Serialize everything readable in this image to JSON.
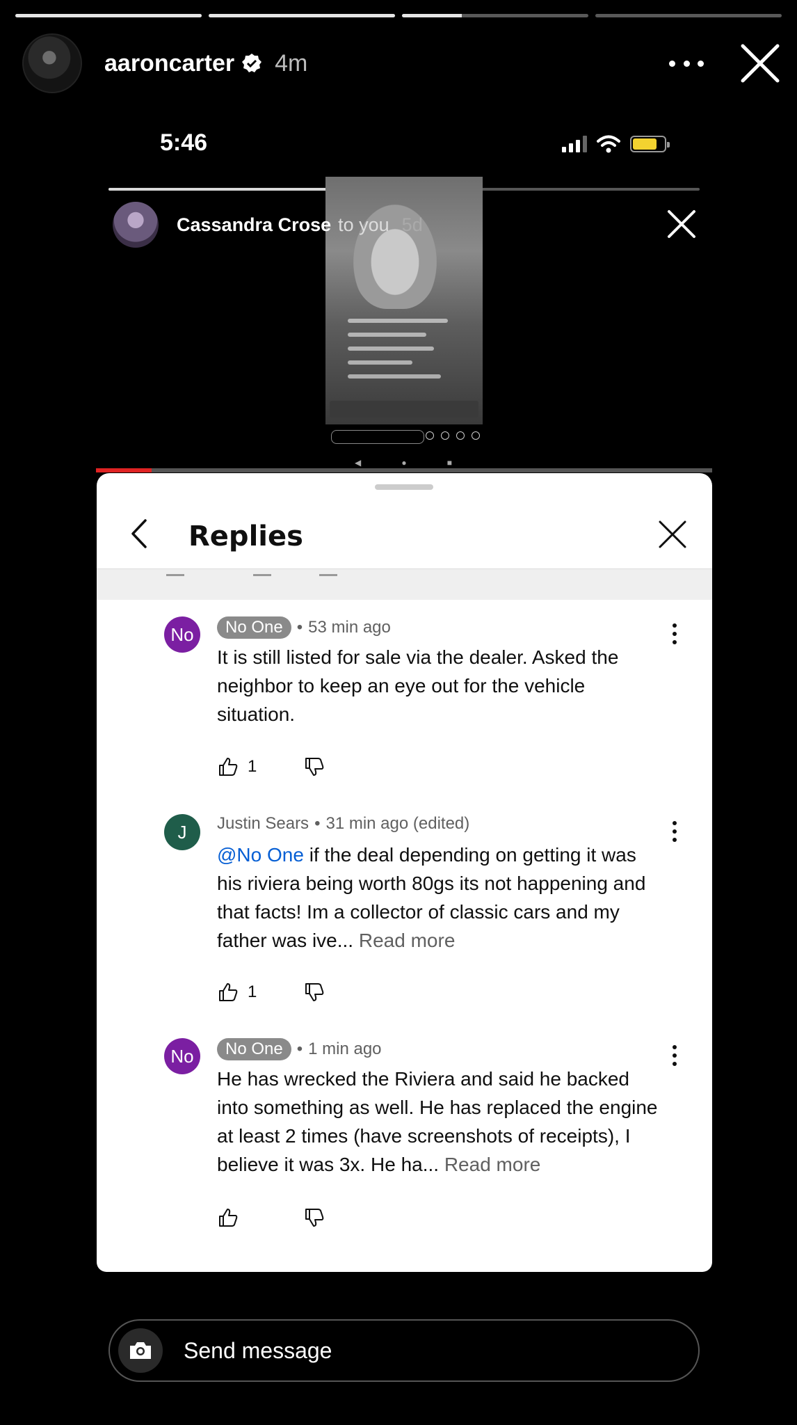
{
  "story": {
    "progress": [
      1.0,
      1.0,
      0.32,
      0.0
    ],
    "username": "aaroncarter",
    "time_ago": "4m",
    "verified": true,
    "more_icon": "more-horizontal-icon",
    "close_icon": "close-icon"
  },
  "phone_status": {
    "time": "5:46",
    "battery_color": "#f2d230"
  },
  "inner_story": {
    "progress": 0.5,
    "username": "Cassandra Crose",
    "to_text": "to you",
    "time_ago": "5d"
  },
  "video_progress": 0.09,
  "replies": {
    "title": "Replies",
    "comments": [
      {
        "avatar": "No",
        "author": "No One",
        "author_badge": true,
        "time": "53 min ago",
        "mention": "",
        "text": "It is still listed for sale via the dealer. Asked the neighbor to keep an eye out for the vehicle situation.",
        "read_more": "",
        "likes": "1"
      },
      {
        "avatar": "J",
        "author": "Justin Sears",
        "author_badge": false,
        "time": "31 min ago (edited)",
        "mention": "@No One",
        "text": " if the deal depending on getting it was his riviera being worth 80gs its not happening and that facts! Im a collector of classic cars and my father was ive...",
        "read_more": "Read more",
        "likes": "1"
      },
      {
        "avatar": "No",
        "author": "No One",
        "author_badge": true,
        "time": "1 min ago",
        "mention": "",
        "text": "He has wrecked the Riviera and said he backed into something as well. He has replaced the engine at least 2 times (have screenshots of receipts), I believe it was 3x. He ha...",
        "read_more": "Read more",
        "likes": ""
      }
    ]
  },
  "send_bar": {
    "placeholder": "Send message",
    "camera_icon": "camera-icon"
  },
  "colors": {
    "mention": "#065fd4",
    "avatar_no_one": "#7b1fa2",
    "avatar_justin": "#1f5d4a",
    "video_progress": "#e02323"
  }
}
